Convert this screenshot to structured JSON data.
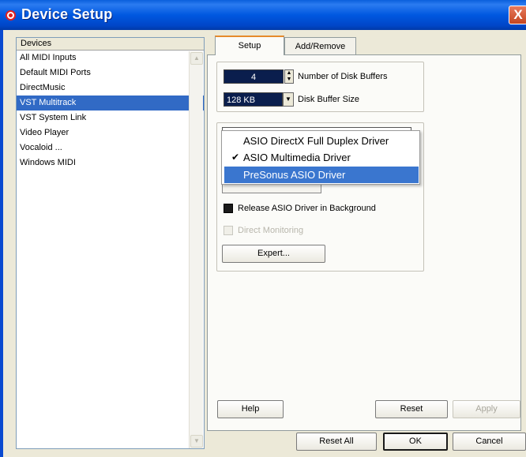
{
  "window": {
    "title": "Device Setup",
    "close_glyph": "X"
  },
  "devices": {
    "header": "Devices",
    "items": [
      {
        "label": "All MIDI Inputs",
        "selected": false
      },
      {
        "label": "Default MIDI Ports",
        "selected": false
      },
      {
        "label": "DirectMusic",
        "selected": false
      },
      {
        "label": "VST Multitrack",
        "selected": true
      },
      {
        "label": "VST System Link",
        "selected": false
      },
      {
        "label": "Video Player",
        "selected": false
      },
      {
        "label": "Vocaloid ...",
        "selected": false
      },
      {
        "label": "Windows MIDI",
        "selected": false
      }
    ]
  },
  "tabs": {
    "setup": "Setup",
    "add_remove": "Add/Remove",
    "active": "Setup"
  },
  "disk": {
    "buffers_value": "4",
    "buffers_label": "Number of Disk Buffers",
    "buffer_size_value": "128 KB",
    "buffer_size_label": "Disk Buffer Size"
  },
  "asio_dropdown": {
    "items": [
      {
        "label": "ASIO DirectX Full Duplex Driver",
        "checked": false,
        "highlighted": false
      },
      {
        "label": "ASIO Multimedia Driver",
        "checked": true,
        "highlighted": false
      },
      {
        "label": "PreSonus ASIO Driver",
        "checked": false,
        "highlighted": true
      }
    ]
  },
  "options": {
    "release_label": "Release ASIO Driver in Background",
    "release_checked": true,
    "direct_monitoring_label": "Direct Monitoring",
    "direct_monitoring_enabled": false,
    "expert_label": "Expert..."
  },
  "buttons": {
    "help": "Help",
    "reset": "Reset",
    "apply": "Apply",
    "reset_all": "Reset All",
    "ok": "OK",
    "cancel": "Cancel"
  },
  "colors": {
    "title_bar": "#0058e0",
    "selection": "#316ac5",
    "field_bg": "#0a1e4d",
    "tab_accent": "#e68b2c"
  }
}
